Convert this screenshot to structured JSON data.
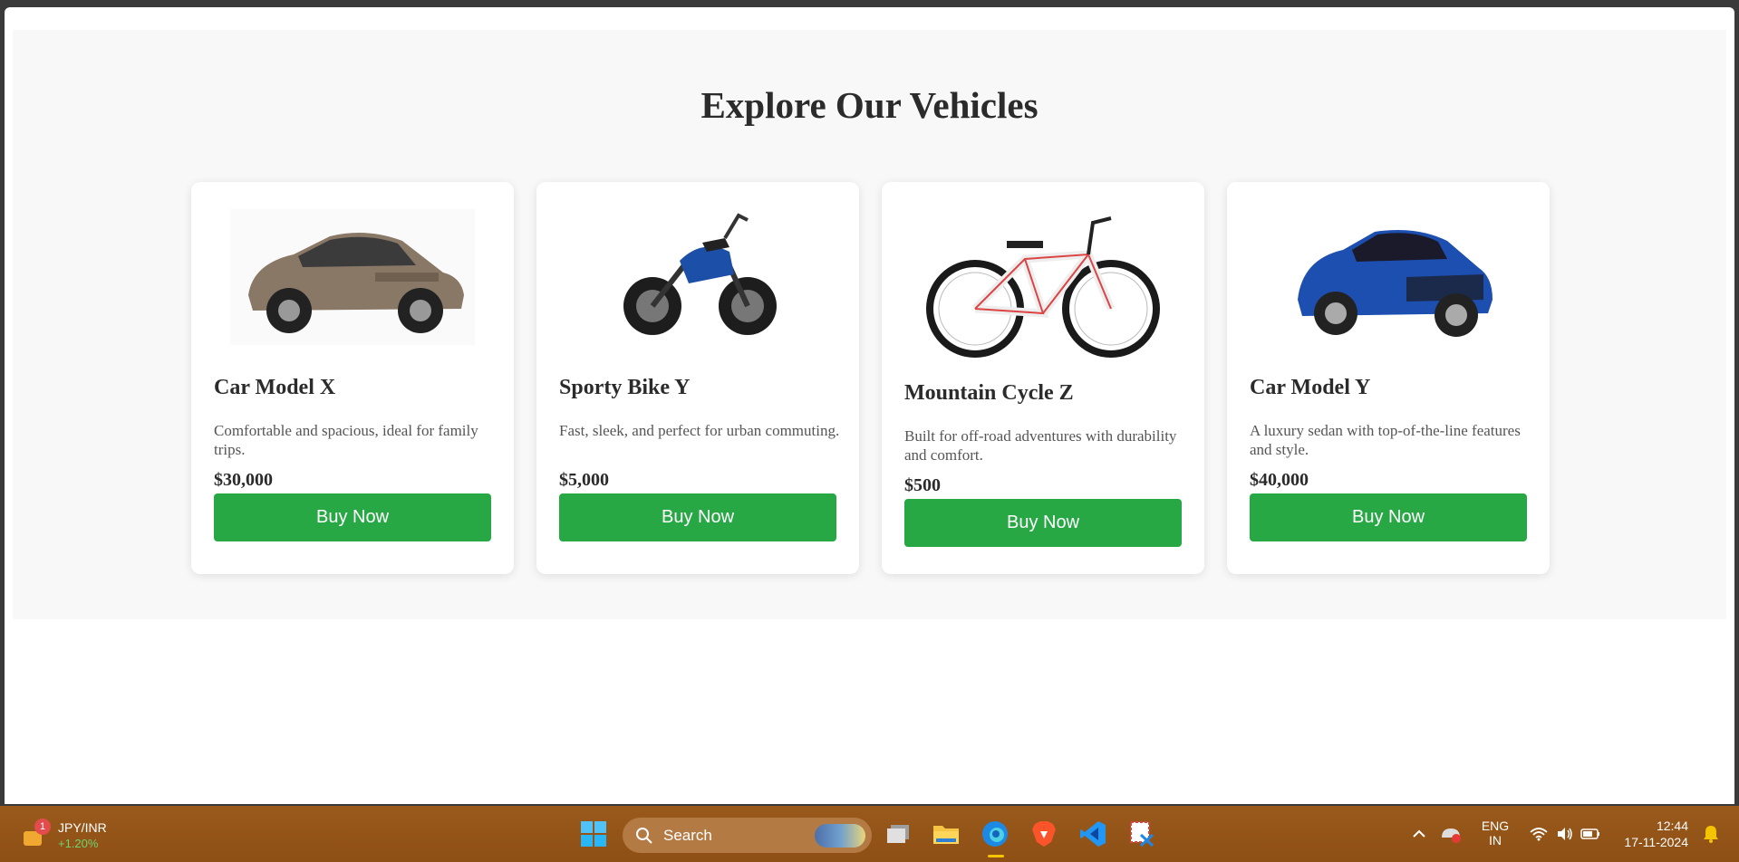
{
  "page": {
    "heading": "Explore Our Vehicles",
    "vehicles": [
      {
        "name": "Car Model X",
        "description": "Comfortable and spacious, ideal for family trips.",
        "price": "$30,000",
        "button": "Buy Now",
        "image": "bronze-suv-image"
      },
      {
        "name": "Sporty Bike Y",
        "description": "Fast, sleek, and perfect for urban commuting.",
        "price": "$5,000",
        "button": "Buy Now",
        "image": "blue-motorcycle-image"
      },
      {
        "name": "Mountain Cycle Z",
        "description": "Built for off-road adventures with durability and comfort.",
        "price": "$500",
        "button": "Buy Now",
        "image": "mountain-bicycle-image"
      },
      {
        "name": "Car Model Y",
        "description": "A luxury sedan with top-of-the-line features and style.",
        "price": "$40,000",
        "button": "Buy Now",
        "image": "blue-crossover-image"
      }
    ],
    "colors": {
      "button": "#28a745",
      "section_bg": "#f8f8f8"
    }
  },
  "taskbar": {
    "ticker": {
      "symbol": "JPY/INR",
      "change": "+1.20%",
      "badge": "1"
    },
    "search_label": "Search",
    "apps": [
      "windows-start-icon",
      "task-view-icon",
      "file-explorer-icon",
      "edge-browser-icon",
      "brave-browser-icon",
      "vscode-icon",
      "snipping-tool-icon"
    ],
    "tray": {
      "language_top": "ENG",
      "language_bottom": "IN",
      "time": "12:44",
      "date": "17-11-2024"
    }
  }
}
